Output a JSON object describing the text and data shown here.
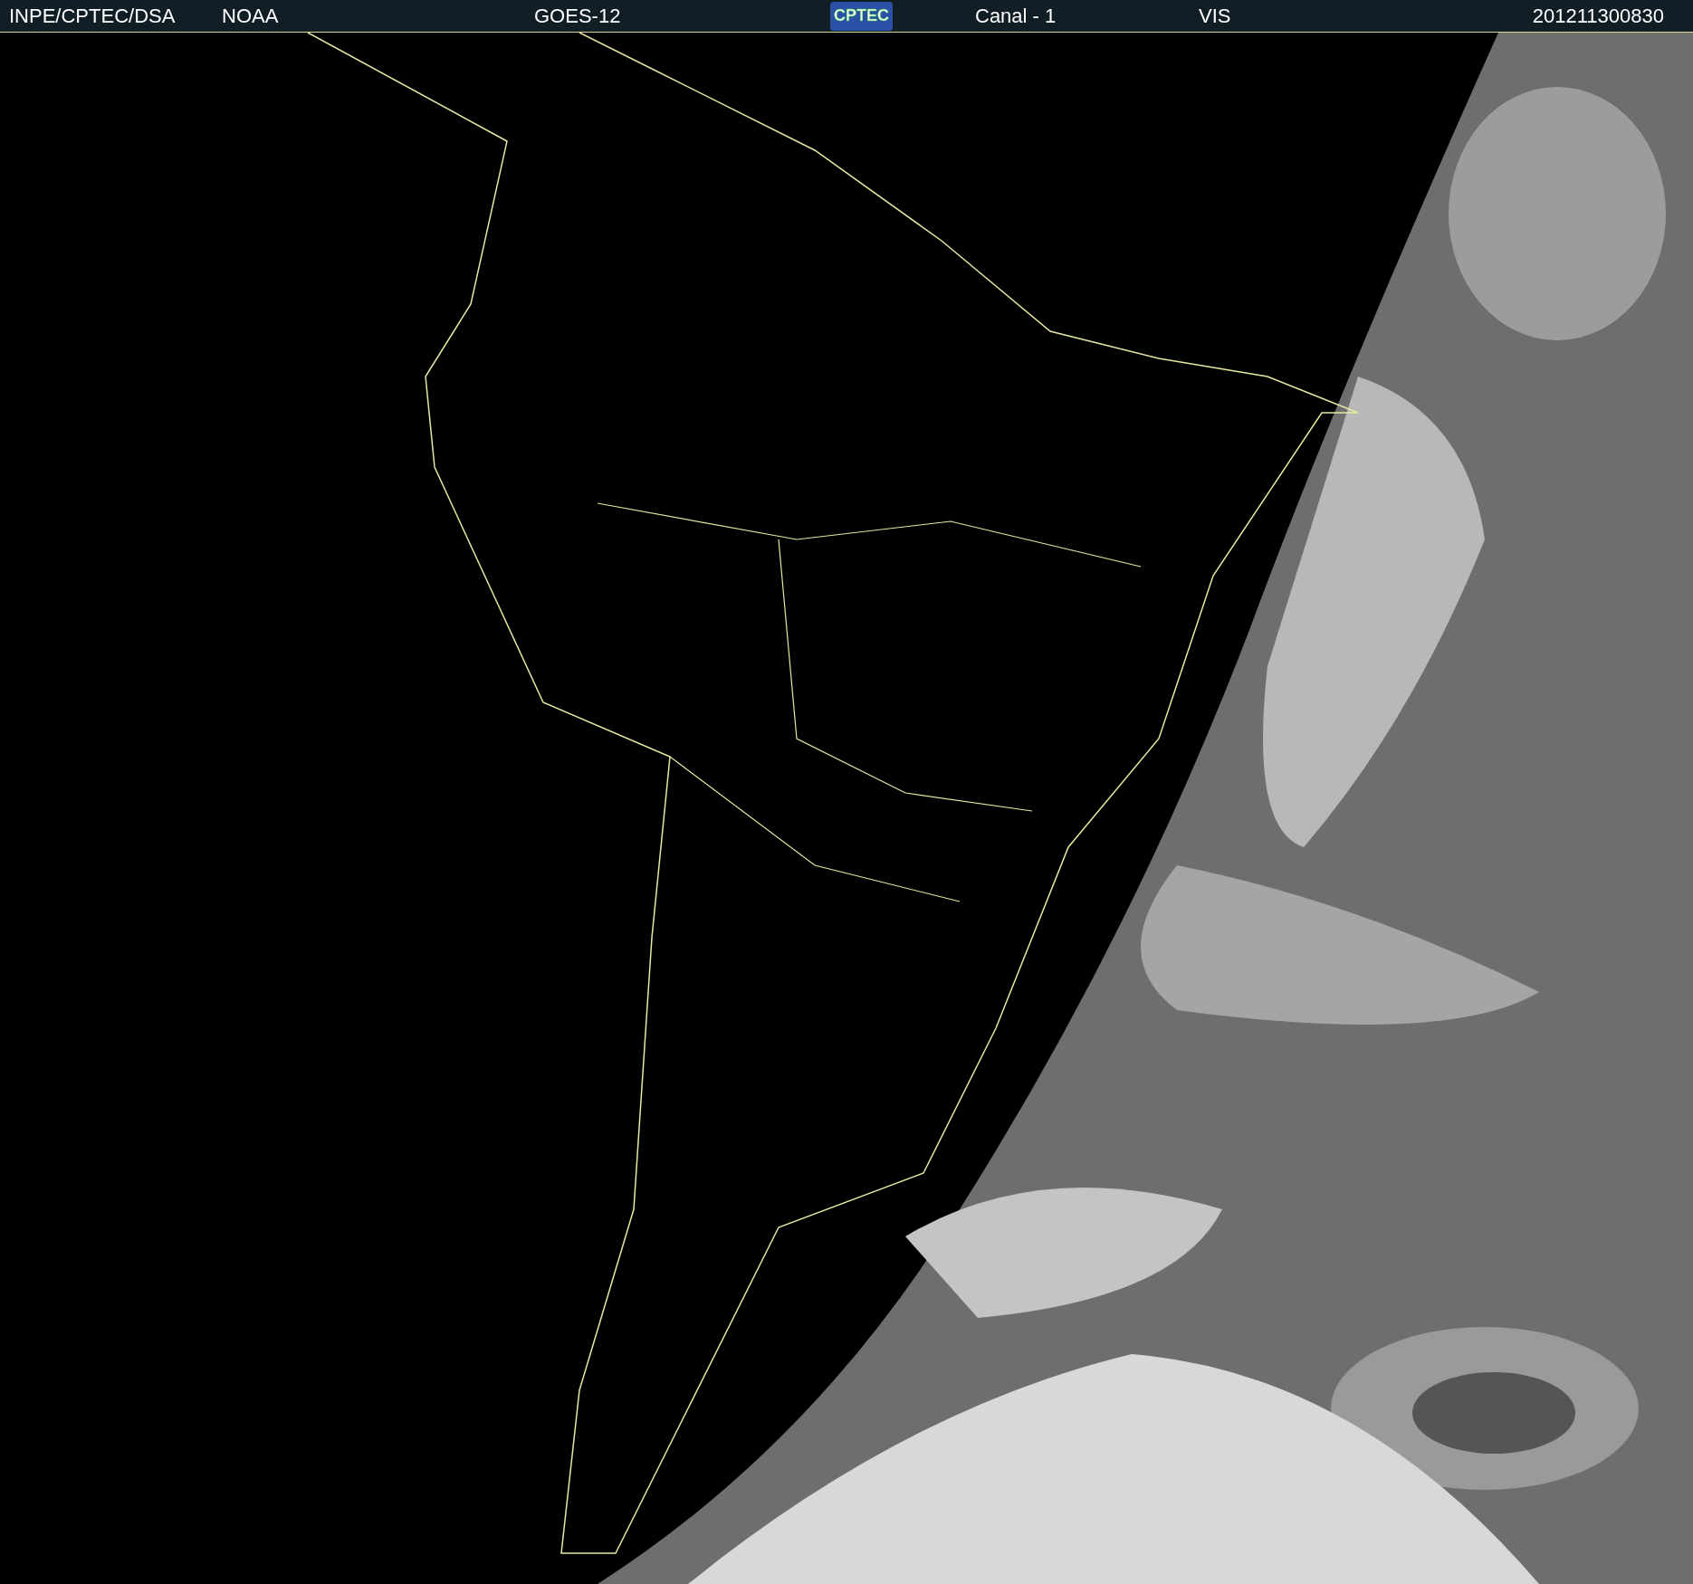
{
  "header": {
    "source": "INPE/CPTEC/DSA",
    "agency": "NOAA",
    "satellite": "GOES-12",
    "logo": "CPTEC",
    "channel": "Canal - 1",
    "band": "VIS",
    "timestamp": "201211300830"
  }
}
